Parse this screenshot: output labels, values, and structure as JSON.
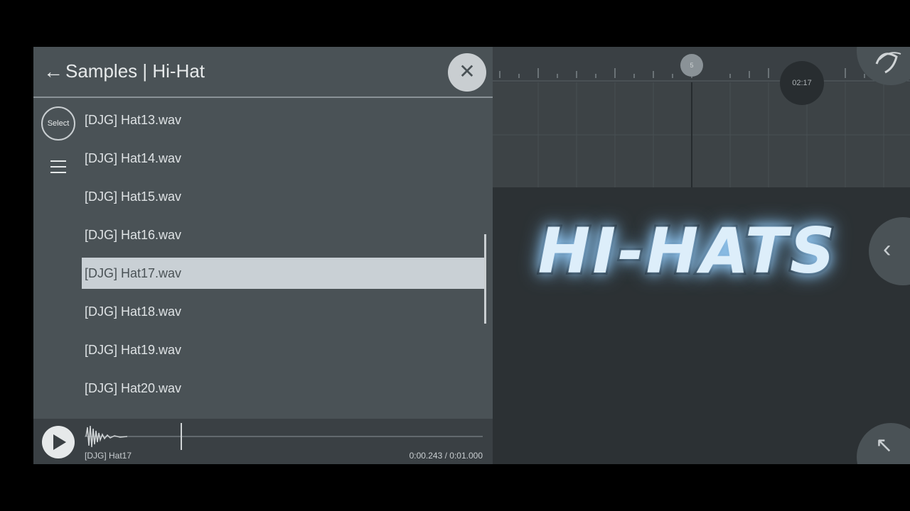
{
  "browser": {
    "title": "Samples | Hi-Hat",
    "back_icon": "back-arrow-icon",
    "close_icon": "close-icon",
    "select_label": "Select",
    "menu_icon": "menu-icon",
    "files": [
      "[DJG] Hat13.wav",
      "[DJG] Hat14.wav",
      "[DJG] Hat15.wav",
      "[DJG] Hat16.wav",
      "[DJG] Hat17.wav",
      "[DJG] Hat18.wav",
      "[DJG] Hat19.wav",
      "[DJG] Hat20.wav"
    ],
    "selected_file": "[DJG] Hat17.wav"
  },
  "player": {
    "play_icon": "play-icon",
    "sample_name": "[DJG] Hat17",
    "time": "0:00.243 / 0:01.000",
    "progress_fraction": 0.243
  },
  "playlist": {
    "song_position_marker": "5",
    "time_display": "02:17"
  },
  "overlay": {
    "title": "HI-HATS"
  },
  "colors": {
    "panel": "#4a5256",
    "selected_row": "#c9d0d5",
    "glow": "#9fd4ff"
  }
}
